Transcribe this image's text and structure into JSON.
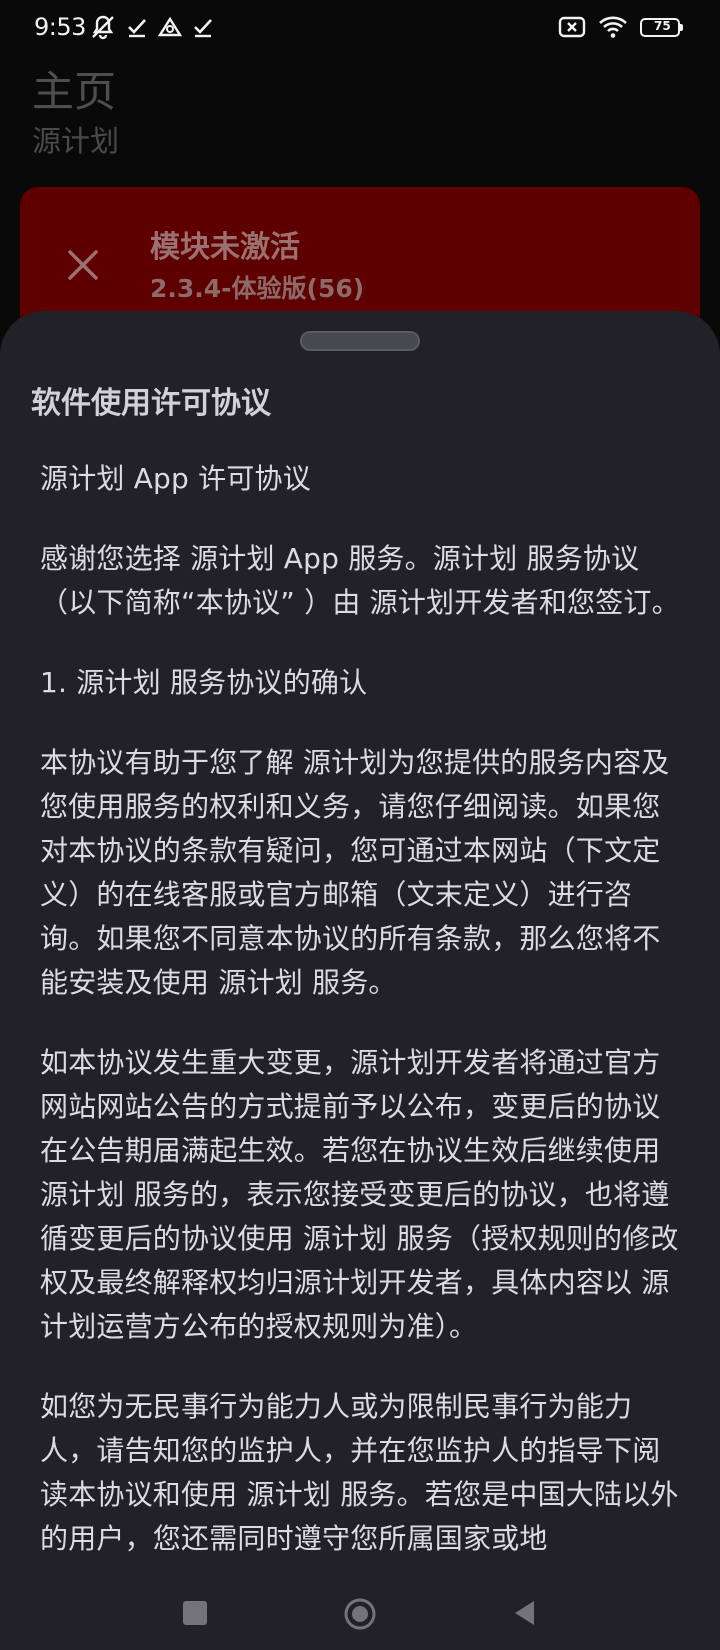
{
  "status_bar": {
    "time": "9:53",
    "left_icons": [
      "mute-vibrate-icon",
      "check-icon",
      "triangle-icon",
      "check-icon"
    ],
    "right_icons": [
      "no-sim-icon",
      "wifi-icon",
      "battery-icon"
    ],
    "battery_level": "75"
  },
  "page": {
    "title": "主页",
    "subtitle": "源计划"
  },
  "module_card": {
    "status_icon": "close-icon",
    "title": "模块未激活",
    "version": "2.3.4-体验版(56)",
    "background_color": "#5f0000"
  },
  "sheet": {
    "title": "软件使用许可协议",
    "paragraphs": [
      "源计划 App 许可协议",
      "感谢您选择 源计划 App 服务。源计划 服务协议（以下简称“本协议” ）由 源计划开发者和您签订。",
      "1. 源计划 服务协议的确认",
      "本协议有助于您了解 源计划为您提供的服务内容及您使用服务的权利和义务，请您仔细阅读。如果您对本协议的条款有疑问，您可通过本网站（下文定义）的在线客服或官方邮箱（文末定义）进行咨询。如果您不同意本协议的所有条款，那么您将不能安装及使用 源计划 服务。",
      "如本协议发生重大变更，源计划开发者将通过官方网站网站公告的方式提前予以公布，变更后的协议在公告期届满起生效。若您在协议生效后继续使用 源计划 服务的，表示您接受变更后的协议，也将遵循变更后的协议使用 源计划 服务（授权规则的修改权及最终解释权均归源计划开发者，具体内容以 源计划运营方公布的授权规则为准）。",
      "如您为无民事行为能力人或为限制民事行为能力人，请告知您的监护人，并在您监护人的指导下阅读本协议和使用 源计划 服务。若您是中国大陆以外的用户，您还需同时遵守您所属国家或地"
    ]
  },
  "nav_bar": {
    "buttons": [
      "recents-icon",
      "home-icon",
      "back-icon"
    ]
  }
}
